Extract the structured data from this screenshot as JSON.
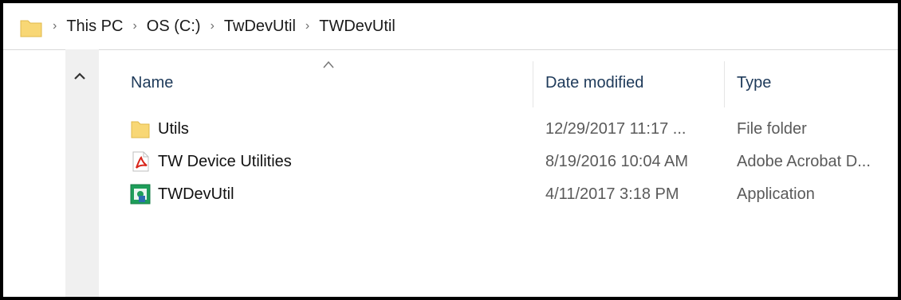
{
  "breadcrumb": {
    "items": [
      "This PC",
      "OS (C:)",
      "TwDevUtil",
      "TWDevUtil"
    ],
    "separator": "›"
  },
  "columns": {
    "name": "Name",
    "date_modified": "Date modified",
    "type": "Type"
  },
  "files": [
    {
      "name": "Utils",
      "date": "12/29/2017 11:17 ...",
      "type": "File folder",
      "icon": "folder-icon"
    },
    {
      "name": "TW Device Utilities",
      "date": "8/19/2016 10:04 AM",
      "type": "Adobe Acrobat D...",
      "icon": "pdf-icon"
    },
    {
      "name": "TWDevUtil",
      "date": "4/11/2017 3:18 PM",
      "type": "Application",
      "icon": "application-icon"
    }
  ],
  "colors": {
    "folder": "#f8d775",
    "pdf_red": "#d9261c",
    "app_green": "#1e9e5a",
    "nav_pane": "#f0f0f0"
  }
}
